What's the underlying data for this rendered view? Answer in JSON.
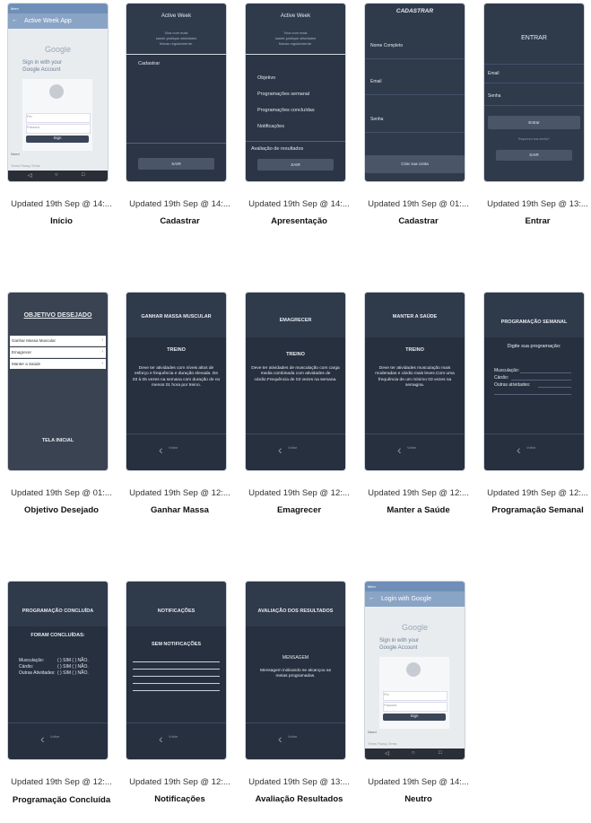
{
  "cards": [
    {
      "updated": "Updated 19th Sep @ 14:...",
      "name": "Início"
    },
    {
      "updated": "Updated 19th Sep @ 14:...",
      "name": "Cadastrar"
    },
    {
      "updated": "Updated 19th Sep @ 14:...",
      "name": "Apresentação"
    },
    {
      "updated": "Updated 19th Sep @ 01:...",
      "name": "Cadastrar"
    },
    {
      "updated": "Updated 19th Sep @ 13:...",
      "name": "Entrar"
    },
    {
      "updated": "Updated 19th Sep @ 01:...",
      "name": "Objetivo Desejado"
    },
    {
      "updated": "Updated 19th Sep @ 12:...",
      "name": "Ganhar Massa"
    },
    {
      "updated": "Updated 19th Sep @ 12:...",
      "name": "Emagrecer"
    },
    {
      "updated": "Updated 19th Sep @ 12:...",
      "name": "Manter a Saúde"
    },
    {
      "updated": "Updated 19th Sep @ 12:...",
      "name": "Programação Semanal"
    },
    {
      "updated": "Updated 19th Sep @ 12:...",
      "name": "Programação Concluída"
    },
    {
      "updated": "Updated 19th Sep @ 12:...",
      "name": "Notificações"
    },
    {
      "updated": "Updated 19th Sep @ 13:...",
      "name": "Avaliação Resultados"
    },
    {
      "updated": "Updated 19th Sep @ 14:...",
      "name": "Neutro"
    }
  ],
  "screens": {
    "inicio": {
      "status": "Merv",
      "appbar": "Active Week App",
      "google": "Google",
      "signin1": "Sign in with your",
      "signin2": "Google Account",
      "pin": "Pin",
      "pass": "Passwd",
      "signin_btn": "Sign",
      "need": "Need",
      "footer": "Terms  Privacy  Terms"
    },
    "cadastrar1": {
      "title": "Active  Week",
      "sub1": "Viva com mais",
      "sub2": "saúde,pratique atividades",
      "sub3": "físicas regularmente.",
      "label": "Cadastrar",
      "btn": "SAIR"
    },
    "apresentacao": {
      "title": "Active  Week",
      "sub1": "Viva com mais",
      "sub2": "saúde,pratique atividades",
      "sub3": "físicas regularmente.",
      "items": [
        "Objetivo",
        "Programações semanal",
        "Programações  concluídas",
        "Notificações"
      ],
      "aval": "Avaliação de resultados",
      "btn": "SAIR"
    },
    "cadastrar2": {
      "title": "CADASTRAR",
      "f1": "Nome Completo",
      "f2": "Email",
      "f3": "Senha",
      "btn": "Criar sua conta"
    },
    "entrar": {
      "title": "ENTRAR",
      "f1": "Email",
      "f2": "Senha",
      "btn": "Entrar",
      "forgot": "Esqueceu sua senha?",
      "sair": "SAIR"
    },
    "objetivo": {
      "title": "OBJETIVO DESEJADO",
      "items": [
        "Ganhar Massa Muscular",
        "Emagrecer",
        "Manter a Saúde"
      ],
      "footer": "TELA INICIAL"
    },
    "ganhar": {
      "title": "GANHAR MASSA MUSCULAR",
      "sub": "TREINO",
      "body": "Deve ter atividades com níveis altos de esforço e frequência e duração elevada.  De 03 à 05 vezes na semana com duração de no menos 01 hora por treino.",
      "back": "Voltar"
    },
    "emagrecer": {
      "title": "EMAGRECER",
      "sub": "TREINO",
      "body": "Deve ter atividades  de musculação com carga media combinada  com atividades de cárdio.Frequência de 03 vezes na semana.",
      "back": "Voltar"
    },
    "manter": {
      "title": "MANTER  A SAÚDE",
      "sub": "TREINO",
      "body": "Deve ter atividades  musculação mais moderadas e cárdio mais leves.Com uma frequência de um mínimo 03 vezes na semagna.",
      "back": "Voltar"
    },
    "semanal": {
      "title": "PROGRAMAÇÃO SEMANAL",
      "sub": "Digite sua programação:",
      "l1": "Musculação:",
      "l2": "Cárdio:",
      "l3": "Outras atividades:",
      "back": "Voltar"
    },
    "concluida": {
      "title": "PROGRAMAÇÃO  CONCLUÍDA",
      "sub": "FORAM CONCLUÍDAS:",
      "l1": "Musculação:",
      "l2": "Cárdio:",
      "l3": "Outras Atividades:",
      "opt": "(  ) SIM  (  ) NÃO.",
      "back": "Voltar"
    },
    "notificacoes": {
      "title": "NOTIFICAÇÕES",
      "sub": "SEM NOTIFICAÇÕES",
      "back": "Voltar"
    },
    "avaliacao": {
      "title": "AVALIAÇÃO DOS RESULTADOS",
      "sub": "MENSAGEM",
      "body": "Mensagem  indicando se alcançou as metas  programadas.",
      "back": "Voltar"
    },
    "neutro": {
      "status": "Merv",
      "appbar": "Login with Google",
      "google": "Google",
      "signin1": "Sign in with your",
      "signin2": "Google Account",
      "pin": "Pin",
      "pass": "Passwd",
      "signin_btn": "Sign",
      "need": "Need",
      "footer": "Terms  Privacy  Terms"
    }
  }
}
